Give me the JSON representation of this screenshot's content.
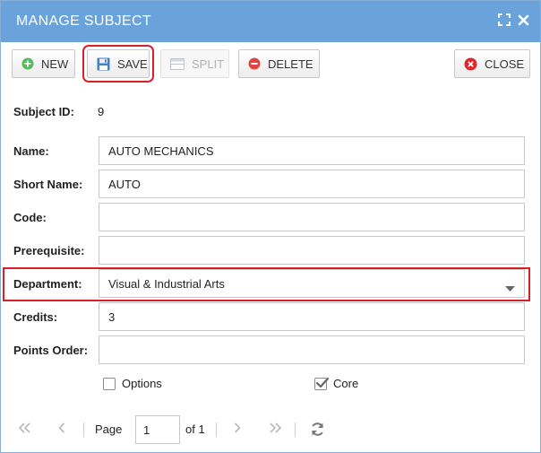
{
  "window": {
    "title": "MANAGE SUBJECT"
  },
  "toolbar": {
    "new_label": "NEW",
    "save_label": "SAVE",
    "split_label": "SPLIT",
    "delete_label": "DELETE",
    "close_label": "CLOSE"
  },
  "form": {
    "subject_id_label": "Subject ID:",
    "subject_id_value": "9",
    "name_label": "Name:",
    "name_value": "AUTO MECHANICS",
    "short_name_label": "Short Name:",
    "short_name_value": "AUTO",
    "code_label": "Code:",
    "code_value": "",
    "prerequisite_label": "Prerequisite:",
    "prerequisite_value": "",
    "department_label": "Department:",
    "department_value": "Visual & Industrial Arts",
    "credits_label": "Credits:",
    "credits_value": "3",
    "points_order_label": "Points Order:",
    "points_order_value": "",
    "options_label": "Options",
    "options_checked": false,
    "core_label": "Core",
    "core_checked": true
  },
  "pager": {
    "page_label": "Page",
    "page_value": "1",
    "of_label": "of 1"
  },
  "colors": {
    "titlebar": "#6aa3dc",
    "highlight": "#d8202a",
    "new_icon": "#5cb85c",
    "delete_icon": "#e04545",
    "close_icon": "#e0262b",
    "save_icon": "#4a7fc1"
  },
  "icons": {
    "maximize": "maximize-icon",
    "close_window": "close-icon",
    "new": "plus-circle-icon",
    "save": "floppy-disk-icon",
    "split": "split-icon",
    "delete": "minus-circle-icon",
    "close": "x-circle-icon",
    "first": "double-chevron-left-icon",
    "prev": "chevron-left-icon",
    "next": "chevron-right-icon",
    "last": "double-chevron-right-icon",
    "refresh": "refresh-icon",
    "dropdown": "caret-down-icon"
  }
}
